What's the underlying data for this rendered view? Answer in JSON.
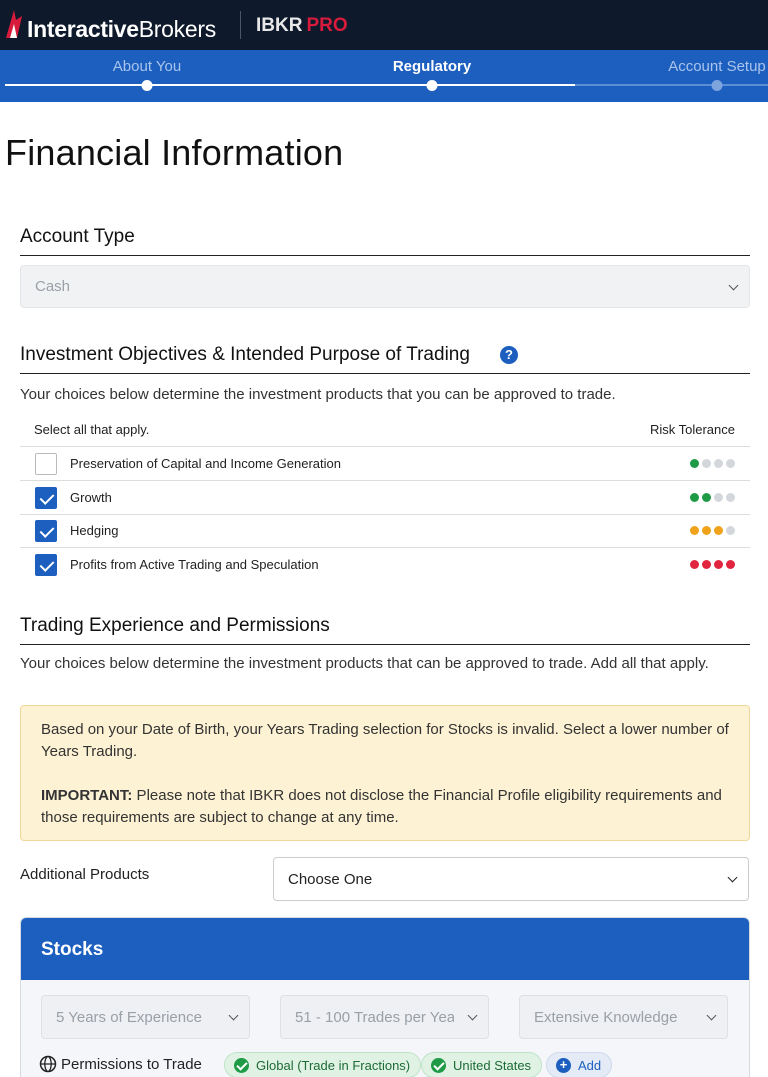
{
  "brand": {
    "name_bold": "Interactive",
    "name_regular": "Brokers",
    "product": "IBKR",
    "tier": "PRO",
    "tier_color": "#d81b3c",
    "header_bg": "#0e1a2b"
  },
  "stepper": {
    "steps": [
      {
        "label": "About You",
        "state": "done"
      },
      {
        "label": "Regulatory",
        "state": "active"
      },
      {
        "label": "Account Setup",
        "state": "todo"
      }
    ],
    "bg": "#1c5fbf"
  },
  "page_title": "Financial Information",
  "account_type": {
    "heading": "Account Type",
    "value": "Cash",
    "disabled": true
  },
  "objectives": {
    "heading": "Investment Objectives & Intended Purpose of Trading",
    "help_icon": "?",
    "description": "Your choices below determine the investment products that you can be approved to trade.",
    "col_left": "Select all that apply.",
    "col_right": "Risk Tolerance",
    "items": [
      {
        "label": "Preservation of Capital and Income Generation",
        "checked": false,
        "risk_level": 1,
        "risk_color": "#1f9a47"
      },
      {
        "label": "Growth",
        "checked": true,
        "risk_level": 2,
        "risk_color": "#1f9a47"
      },
      {
        "label": "Hedging",
        "checked": true,
        "risk_level": 3,
        "risk_color": "#efa21a"
      },
      {
        "label": "Profits from Active Trading and Speculation",
        "checked": true,
        "risk_level": 4,
        "risk_color": "#e0253f"
      }
    ]
  },
  "trading": {
    "heading": "Trading Experience and Permissions",
    "description": "Your choices below determine the investment products that can be approved to trade. Add all that apply."
  },
  "alert": {
    "message": "Based on your Date of Birth, your Years Trading selection for Stocks is invalid. Select a lower number of Years Trading.",
    "important_label": "IMPORTANT:",
    "important_text": " Please note that IBKR does not disclose the Financial Profile eligibility requirements and those requirements are subject to change at any time."
  },
  "additional_products": {
    "label": "Additional Products",
    "value": "Choose One"
  },
  "stocks": {
    "title": "Stocks",
    "years": "5 Years of Experience",
    "trades": "51 - 100 Trades per Year",
    "knowledge": "Extensive Knowledge",
    "permissions_label": "Permissions to Trade",
    "chips": [
      {
        "label": "Global (Trade in Fractions)",
        "kind": "check-circle-icon"
      },
      {
        "label": "United States",
        "kind": "check-circle-icon"
      }
    ],
    "add_label": "Add"
  }
}
